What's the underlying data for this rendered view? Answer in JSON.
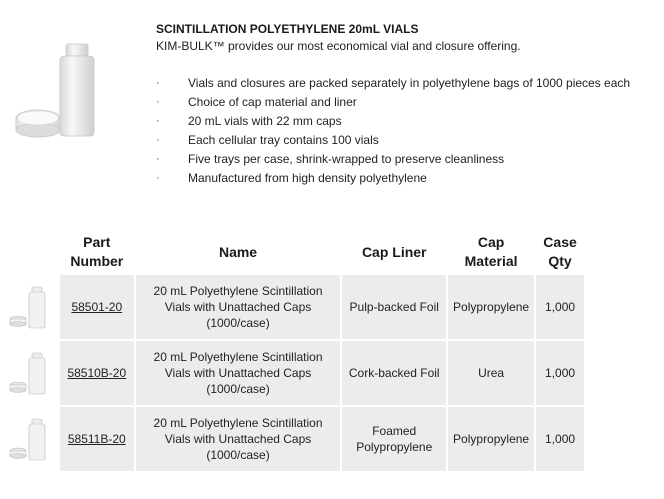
{
  "product": {
    "title": "SCINTILLATION POLYETHYLENE 20mL VIALS",
    "subtitle": "KIM-BULK™ provides our most economical vial and closure offering.",
    "bullet_glyph": "·",
    "bullets": [
      "Vials and closures are packed separately in polyethylene bags of 1000 pieces each",
      "Choice of cap material and liner",
      "20 mL vials with 22 mm caps",
      "Each cellular tray contains 100 vials",
      "Five trays per case, shrink-wrapped to preserve cleanliness",
      "Manufactured from high density polyethylene"
    ]
  },
  "table": {
    "headers": {
      "part_number_1": "Part",
      "part_number_2": "Number",
      "name": "Name",
      "cap_liner": "Cap Liner",
      "cap_material_1": "Cap",
      "cap_material_2": "Material",
      "case_qty_1": "Case",
      "case_qty_2": "Qty"
    },
    "rows": [
      {
        "part_number": "58501-20",
        "name_1": "20 mL Polyethylene Scintillation",
        "name_2": "Vials with Unattached Caps",
        "name_3": "(1000/case)",
        "cap_liner_1": "Pulp-backed Foil",
        "cap_liner_2": "",
        "cap_material": "Polypropylene",
        "case_qty": "1,000"
      },
      {
        "part_number": "58510B-20",
        "name_1": "20 mL Polyethylene Scintillation",
        "name_2": "Vials with Unattached Caps",
        "name_3": "(1000/case)",
        "cap_liner_1": "Cork-backed Foil",
        "cap_liner_2": "",
        "cap_material": "Urea",
        "case_qty": "1,000"
      },
      {
        "part_number": "58511B-20",
        "name_1": "20 mL Polyethylene Scintillation",
        "name_2": "Vials with Unattached Caps",
        "name_3": "(1000/case)",
        "cap_liner_1": "Foamed",
        "cap_liner_2": "Polypropylene",
        "cap_material": "Polypropylene",
        "case_qty": "1,000"
      }
    ]
  }
}
